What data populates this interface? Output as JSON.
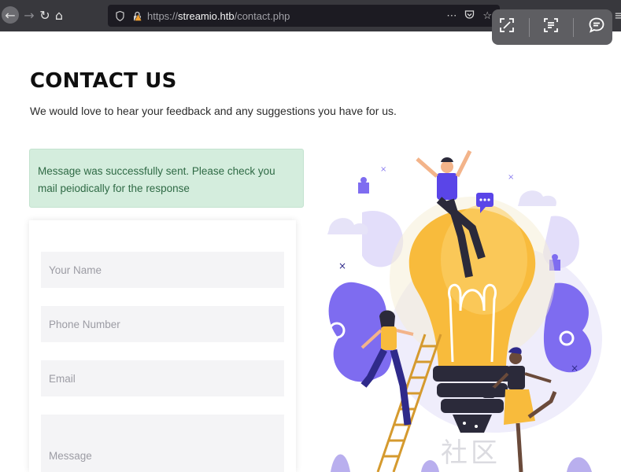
{
  "browser": {
    "url_scheme": "https://",
    "url_host": "streamio.htb",
    "url_path": "/contact.php",
    "overflow_menu": "⋯"
  },
  "page": {
    "title": "CONTACT US",
    "subtitle": "We would love to hear your feedback and any suggestions you have for us."
  },
  "alert": {
    "message": "Message was successfully sent. Please check you mail peiodically for the response"
  },
  "form": {
    "name_placeholder": "Your Name",
    "phone_placeholder": "Phone Number",
    "email_placeholder": "Email",
    "message_placeholder": "Message"
  },
  "watermark": {
    "text": "社区"
  },
  "colors": {
    "alert_bg": "#d4eddd",
    "alert_text": "#2f6a45",
    "bulb": "#f8bb3c",
    "accent_purple": "#5a45e8"
  }
}
